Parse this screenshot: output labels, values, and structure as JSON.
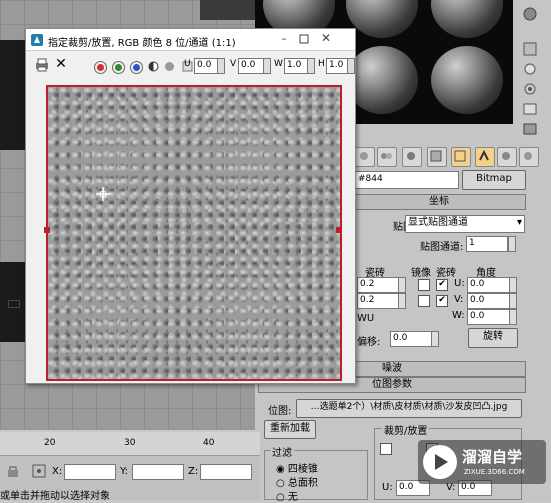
{
  "dialog": {
    "title": "指定裁剪/放置, RGB 颜色 8 位/通道 (1:1)",
    "u_label": "U",
    "u_value": "0.0",
    "v_label": "V",
    "v_value": "0.0",
    "w_label": "W",
    "w_value": "1.0",
    "h_label": "H",
    "h_value": "1.0"
  },
  "material": {
    "map_name": "#844",
    "map_type": "Bitmap",
    "coords_title": "坐标",
    "mapping_label": "贴图:",
    "mapping_value": "显式贴图通道",
    "channel_label": "贴图通道:",
    "channel_value": "1",
    "tiling_label": "瓷砖",
    "mirror_label": "镜像",
    "tile_label": "瓷砖",
    "angle_label": "角度",
    "tiling_u": "0.2",
    "tiling_v": "0.2",
    "angle_u_label": "U:",
    "angle_u": "0.0",
    "angle_v_label": "V:",
    "angle_v": "0.0",
    "angle_w_label": "W:",
    "angle_w": "0.0",
    "wu_label": "WU",
    "blur_offset_label": "偏移:",
    "blur_offset_value": "0.0",
    "rotate_button": "旋转",
    "noise_title": "噪波",
    "bitmap_params_title": "位图参数",
    "bitmap_label": "位图:",
    "bitmap_path": "…选题单2个）\\材质\\皮材质\\材质\\沙发皮凹凸.jpg",
    "reload_button": "重新加载",
    "crop_title": "裁剪/放置",
    "filter_title": "过滤",
    "filter_pyramidal": "四棱锥",
    "filter_summed": "总面积",
    "filter_none": "无",
    "crop_u_label": "U:",
    "crop_u": "0.0",
    "crop_v_label": "V:",
    "crop_v": "0.0"
  },
  "bottom": {
    "ruler_20": "20",
    "ruler_30": "30",
    "ruler_40": "40",
    "x_label": "X:",
    "y_label": "Y:",
    "z_label": "Z:",
    "status": "或单击并拖动以选择对象"
  },
  "watermark": {
    "brand": "溜溜自学",
    "url": "ZIXUE.3D66.COM"
  },
  "colors": {
    "red_channel": "#d0302a",
    "green_channel": "#2e8b2e",
    "blue_channel": "#2a55c8",
    "crop_frame": "#b8202a"
  }
}
